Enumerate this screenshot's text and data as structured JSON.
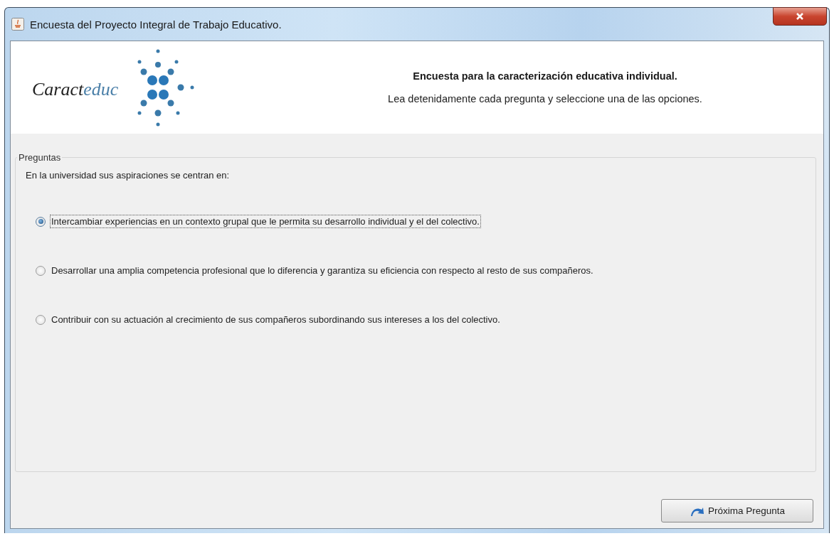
{
  "window": {
    "title": "Encuesta del Proyecto Integral de Trabajo Educativo."
  },
  "header": {
    "logo_parts": [
      "Caract",
      "educ"
    ],
    "title": "Encuesta para la caracterización educativa individual.",
    "subtitle": "Lea detenidamente cada pregunta y seleccione una de las opciones."
  },
  "group": {
    "title": "Preguntas",
    "question": "En la universidad sus aspiraciones se centran en:",
    "options": [
      {
        "label": "Intercambiar experiencias en un contexto grupal que le permita su desarrollo individual y el del colectivo.",
        "selected": true
      },
      {
        "label": "Desarrollar una amplia competencia profesional que lo diferencia y garantiza su eficiencia con respecto al resto de sus compañeros.",
        "selected": false
      },
      {
        "label": "Contribuir con su actuación al crecimiento de sus compañeros subordinando sus intereses a los del colectivo.",
        "selected": false
      }
    ]
  },
  "buttons": [
    {
      "label": "Próxima Pregunta"
    }
  ]
}
